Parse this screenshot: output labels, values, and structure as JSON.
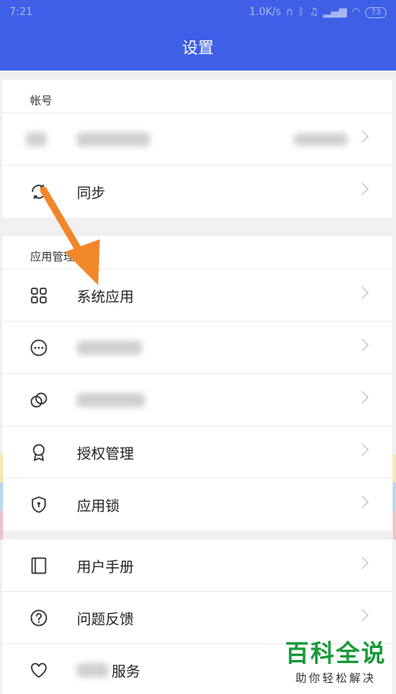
{
  "status": {
    "time": "7:21",
    "speed": "1.0K/s",
    "battery": "73"
  },
  "header": {
    "title": "设置"
  },
  "account": {
    "title": "帐号",
    "sync_label": "同步"
  },
  "app_mgmt": {
    "title": "应用管理",
    "system_apps_label": "系统应用",
    "permission_label": "授权管理",
    "app_lock_label": "应用锁"
  },
  "more": {
    "manual_label": "用户手册",
    "feedback_label": "问题反馈",
    "service_label_visible": "服务"
  },
  "watermark": {
    "brand": "百科全说",
    "slogan": "助你轻松解决"
  },
  "colors": {
    "header": "#3e5fe6",
    "arrow": "#f2872a",
    "watermark": "#1b9a3a"
  }
}
